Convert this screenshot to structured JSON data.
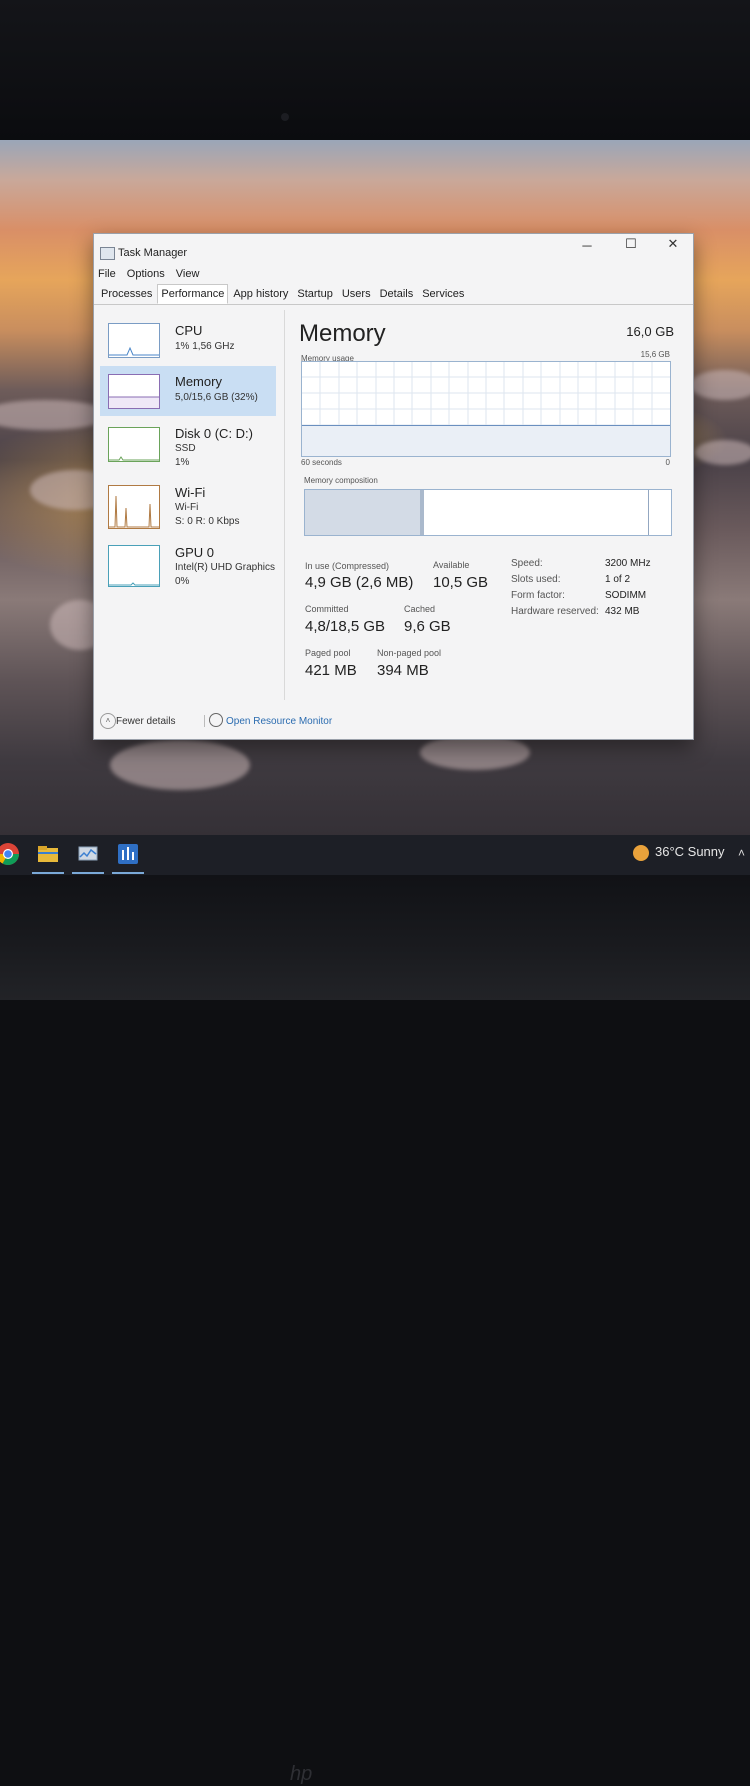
{
  "window": {
    "title": "Task Manager",
    "menu": [
      "File",
      "Options",
      "View"
    ],
    "tabs": [
      "Processes",
      "Performance",
      "App history",
      "Startup",
      "Users",
      "Details",
      "Services"
    ],
    "active_tab": "Performance"
  },
  "sidebar": {
    "items": [
      {
        "title": "CPU",
        "sub1": "1% 1,56 GHz",
        "sub2": ""
      },
      {
        "title": "Memory",
        "sub1": "5,0/15,6 GB (32%)",
        "sub2": ""
      },
      {
        "title": "Disk 0 (C: D:)",
        "sub1": "SSD",
        "sub2": "1%"
      },
      {
        "title": "Wi-Fi",
        "sub1": "Wi-Fi",
        "sub2": "S: 0 R: 0 Kbps"
      },
      {
        "title": "GPU 0",
        "sub1": "Intel(R) UHD Graphics",
        "sub2": "0%"
      }
    ]
  },
  "memory": {
    "title": "Memory",
    "total": "16,0 GB",
    "graph_label": "Memory usage",
    "graph_max": "15,6 GB",
    "graph_time": "60 seconds",
    "graph_zero": "0",
    "composition_label": "Memory composition",
    "usage_fraction": 0.32,
    "stats": {
      "in_use_label": "In use (Compressed)",
      "in_use": "4,9 GB (2,6 MB)",
      "available_label": "Available",
      "available": "10,5 GB",
      "committed_label": "Committed",
      "committed": "4,8/18,5 GB",
      "cached_label": "Cached",
      "cached": "9,6 GB",
      "paged_label": "Paged pool",
      "paged": "421 MB",
      "nonpaged_label": "Non-paged pool",
      "nonpaged": "394 MB"
    },
    "details": [
      {
        "label": "Speed:",
        "value": "3200 MHz"
      },
      {
        "label": "Slots used:",
        "value": "1 of 2"
      },
      {
        "label": "Form factor:",
        "value": "SODIMM"
      },
      {
        "label": "Hardware reserved:",
        "value": "432 MB"
      }
    ]
  },
  "footer": {
    "fewer": "Fewer details",
    "monitor": "Open Resource Monitor"
  },
  "taskbar": {
    "weather": "36°C Sunny",
    "icons": [
      "chrome-icon",
      "file-explorer-icon",
      "task-manager-icon",
      "app-icon"
    ]
  },
  "colors": {
    "accent_blue": "#2b6cb0",
    "selection": "#c9def3",
    "graph_border": "#9ab3cf"
  }
}
